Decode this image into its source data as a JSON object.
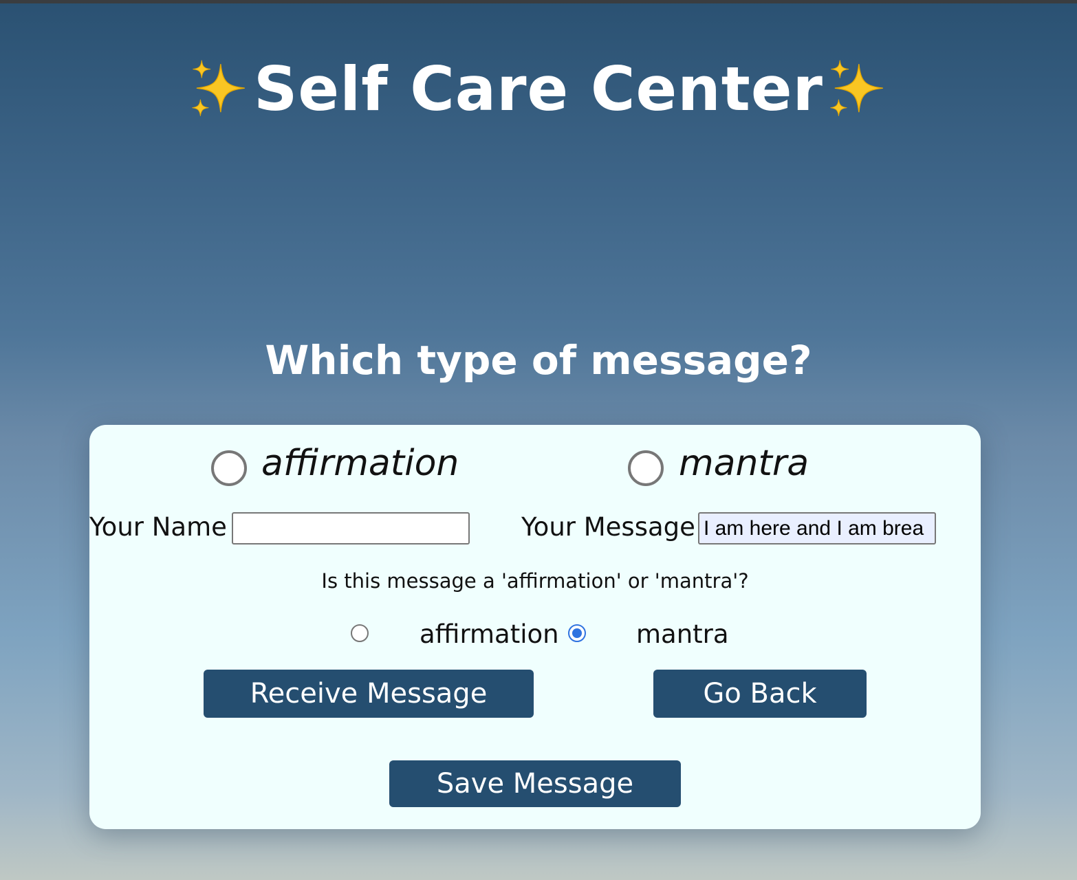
{
  "header": {
    "title": "Self Care Center",
    "sparkle_icon": "sparkles-icon"
  },
  "subtitle": "Which type of message?",
  "choice": {
    "options": [
      {
        "label": "affirmation",
        "selected": false
      },
      {
        "label": "mantra",
        "selected": false
      }
    ]
  },
  "form": {
    "name_label": "Your Name",
    "name_value": "",
    "message_label": "Your Message",
    "message_value": "I am here and I am brea",
    "question": "Is this message a 'affirmation' or 'mantra'?",
    "type_options": [
      {
        "label": "affirmation",
        "selected": false
      },
      {
        "label": "mantra",
        "selected": true
      }
    ]
  },
  "buttons": {
    "receive": "Receive Message",
    "back": "Go Back",
    "save": "Save Message"
  },
  "colors": {
    "button": "#254e70",
    "card": "#f0fffe",
    "radio_checked": "#2f73e0"
  }
}
